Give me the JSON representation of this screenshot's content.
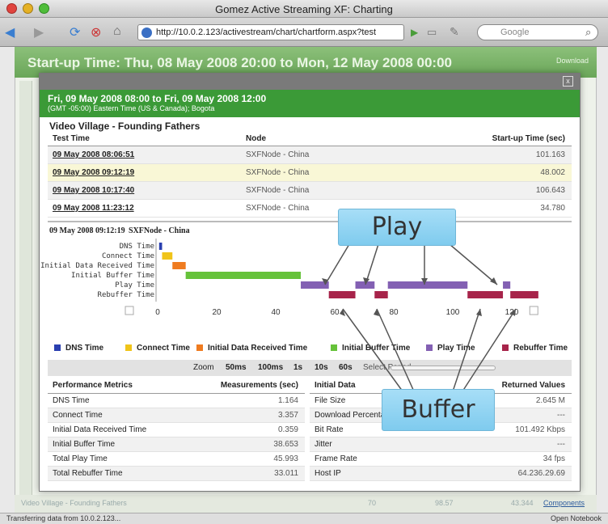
{
  "window": {
    "title": "Gomez Active Streaming XF: Charting"
  },
  "toolbar": {
    "url": "http://10.0.2.123/activestream/chart/chartform.aspx?test",
    "search_placeholder": "Google"
  },
  "page": {
    "title": "Start-up Time: Thu, 08 May 2008 20:00 to Mon, 12 May 2008 00:00",
    "download_label": "Download",
    "footer_row": {
      "name": "Video Village - Founding Fathers",
      "v1": "70",
      "v2": "98.57",
      "v3": "43.344",
      "link": "Components"
    }
  },
  "modal": {
    "close_label": "x",
    "date_range": "Fri, 09 May 2008 08:00 to Fri, 09 May 2008 12:00",
    "timezone": "(GMT -05:00) Eastern Time (US & Canada); Bogota",
    "section_title": "Video Village - Founding Fathers",
    "tests_table": {
      "headers": [
        "Test Time",
        "Node",
        "Start-up Time (sec)"
      ],
      "rows": [
        {
          "time": "09 May 2008 08:06:51",
          "node": "SXFNode - China",
          "startup": "101.163"
        },
        {
          "time": "09 May 2008 09:12:19",
          "node": "SXFNode - China",
          "startup": "48.002"
        },
        {
          "time": "09 May 2008 10:17:40",
          "node": "SXFNode - China",
          "startup": "106.643"
        },
        {
          "time": "09 May 2008 11:23:12",
          "node": "SXFNode - China",
          "startup": "34.780"
        }
      ]
    },
    "chart_header": {
      "time": "09 May 2008 09:12:19",
      "node": "SXFNode - China"
    },
    "zoom": {
      "label": "Zoom",
      "levels": [
        "50ms",
        "100ms",
        "1s",
        "10s",
        "60s"
      ],
      "select_period": "Select Period"
    },
    "metrics": {
      "header_left": "Performance Metrics",
      "header_mid": "Measurements (sec)",
      "header_right_left": "Initial Data",
      "header_right": "Returned Values",
      "left": [
        {
          "name": "DNS Time",
          "value": "1.164"
        },
        {
          "name": "Connect Time",
          "value": "3.357"
        },
        {
          "name": "Initial Data Received Time",
          "value": "0.359"
        },
        {
          "name": "Initial Buffer Time",
          "value": "38.653"
        },
        {
          "name": "Total Play Time",
          "value": "45.993"
        },
        {
          "name": "Total Rebuffer Time",
          "value": "33.011"
        }
      ],
      "right": [
        {
          "name": "File Size",
          "value": "2.645 M"
        },
        {
          "name": "Download Percentage",
          "value": "---"
        },
        {
          "name": "Bit Rate",
          "value": "101.492 Kbps"
        },
        {
          "name": "Jitter",
          "value": "---"
        },
        {
          "name": "Frame Rate",
          "value": "34 fps"
        },
        {
          "name": "Host IP",
          "value": "64.236.29.69"
        }
      ]
    }
  },
  "callouts": {
    "play": "Play",
    "buffer": "Buffer"
  },
  "status_bar": {
    "text": "Transferring data from 10.0.2.123...",
    "right": "Open Notebook"
  },
  "chart_data": {
    "type": "bar",
    "orientation": "horizontal-gantt",
    "categories": [
      "DNS Time",
      "Connect Time",
      "Initial Data Received Time",
      "Initial Buffer Time",
      "Play Time",
      "Rebuffer Time"
    ],
    "xlim": [
      0,
      125
    ],
    "xticks": [
      0,
      20,
      40,
      60,
      80,
      100,
      120
    ],
    "series": [
      {
        "name": "DNS Time",
        "color": "#2a3fb0",
        "segments": [
          [
            0.5,
            1.5
          ]
        ]
      },
      {
        "name": "Connect Time",
        "color": "#f0c419",
        "segments": [
          [
            1.5,
            5
          ]
        ]
      },
      {
        "name": "Initial Data Received Time",
        "color": "#ef7b20",
        "segments": [
          [
            5,
            9.5
          ]
        ]
      },
      {
        "name": "Initial Buffer Time",
        "color": "#66c23a",
        "segments": [
          [
            9.5,
            48.5
          ]
        ]
      },
      {
        "name": "Play Time",
        "color": "#8360b3",
        "segments": [
          [
            48.5,
            58
          ],
          [
            67,
            73.5
          ],
          [
            78,
            105
          ],
          [
            117,
            119.5
          ]
        ]
      },
      {
        "name": "Rebuffer Time",
        "color": "#a7244a",
        "segments": [
          [
            58,
            67
          ],
          [
            73.5,
            78
          ],
          [
            105,
            117
          ],
          [
            119.5,
            129
          ]
        ]
      }
    ]
  }
}
